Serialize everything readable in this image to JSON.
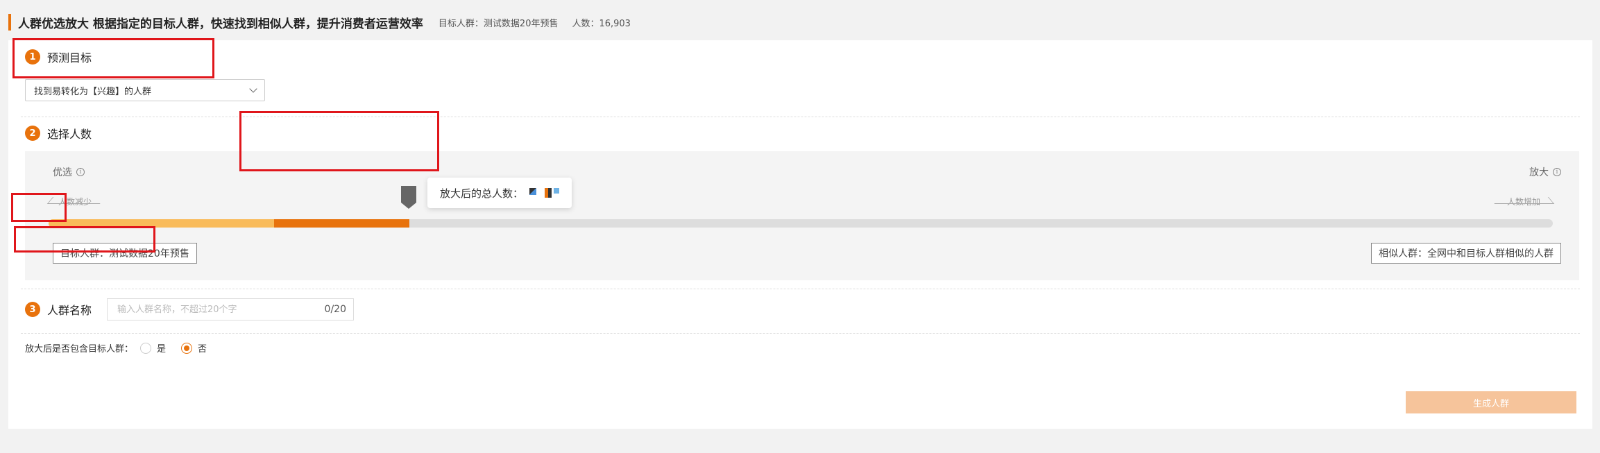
{
  "header": {
    "title": "人群优选放大 根据指定的目标人群，快速找到相似人群，提升消费者运营效率",
    "target_label": "目标人群：测试数据20年预售",
    "count_label": "人数：16,903"
  },
  "step1": {
    "number": "1",
    "title": "预测目标",
    "select_value": "找到易转化为【兴趣】的人群"
  },
  "step2": {
    "number": "2",
    "title": "选择人数",
    "left_label": "优选",
    "right_label": "放大",
    "left_hint": "人数减少",
    "right_hint": "人数增加",
    "info_glyph": "i",
    "tooltip_label": "放大后的总人数：",
    "slider": {
      "light_fill": 0.15,
      "dark_fill": 0.24,
      "light_color": "#f9bb5a",
      "dark_color": "#e8720c",
      "track_color": "#dddddd"
    },
    "target_button": "目标人群：测试数据20年预售",
    "similar_button": "相似人群：全网中和目标人群相似的人群"
  },
  "step3": {
    "number": "3",
    "title": "人群名称",
    "input_placeholder": "输入人群名称，不超过20个字",
    "input_value": "",
    "char_count": "0/20"
  },
  "include_target": {
    "label": "放大后是否包含目标人群：",
    "options": [
      "是",
      "否"
    ],
    "selected": "否"
  },
  "submit_label": "生成人群",
  "colors": {
    "accent": "#e8720c",
    "highlight_box": "#e0161b",
    "submit_disabled": "#f6c49b"
  }
}
